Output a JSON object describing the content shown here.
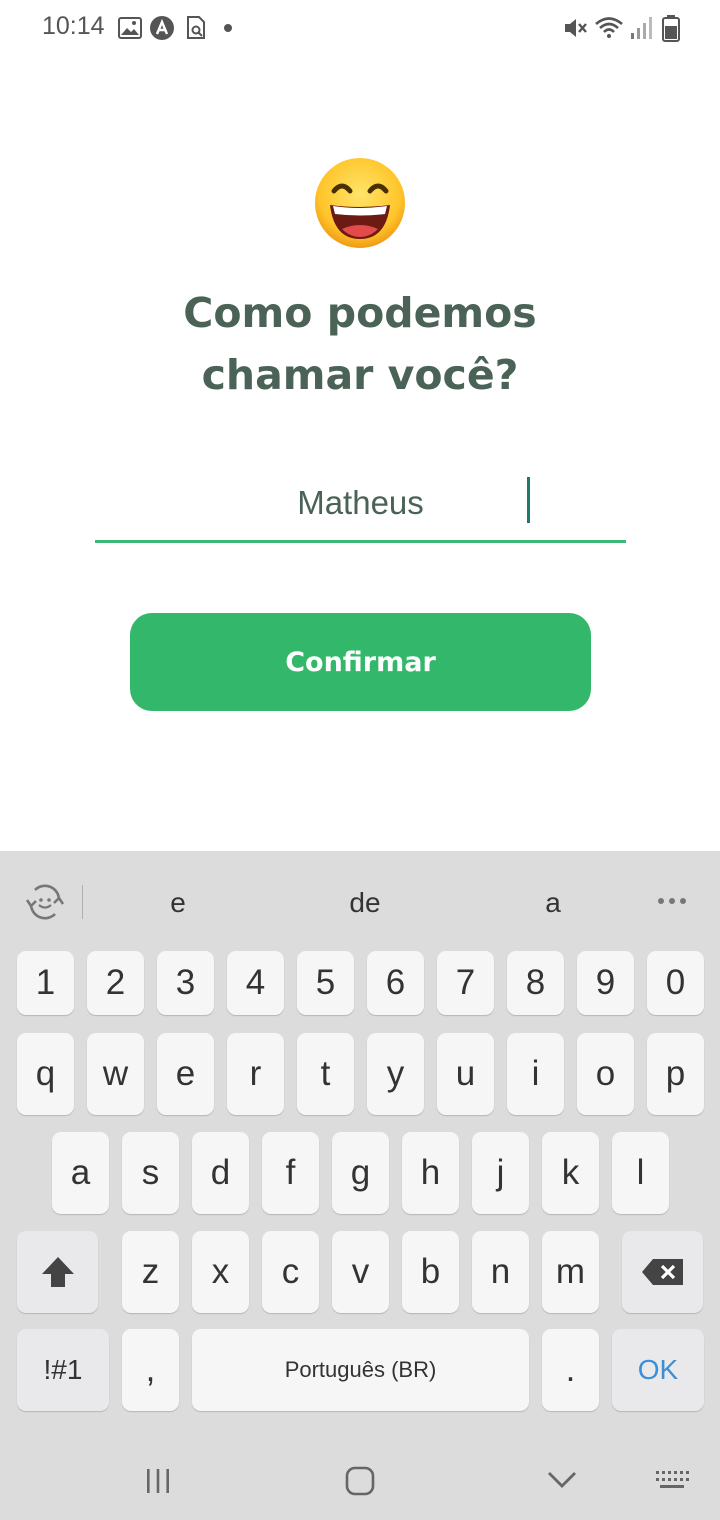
{
  "status_bar": {
    "time": "10:14"
  },
  "screen": {
    "title_line1": "Como podemos",
    "title_line2": "chamar você?",
    "name_input_value": "Matheus",
    "confirm_label": "Confirmar"
  },
  "keyboard": {
    "suggestions": [
      "e",
      "de",
      "a"
    ],
    "number_row": [
      "1",
      "2",
      "3",
      "4",
      "5",
      "6",
      "7",
      "8",
      "9",
      "0"
    ],
    "row1": [
      "q",
      "w",
      "e",
      "r",
      "t",
      "y",
      "u",
      "i",
      "o",
      "p"
    ],
    "row2": [
      "a",
      "s",
      "d",
      "f",
      "g",
      "h",
      "j",
      "k",
      "l"
    ],
    "row3": [
      "z",
      "x",
      "c",
      "v",
      "b",
      "n",
      "m"
    ],
    "symbols_label": "!#1",
    "comma_label": ",",
    "space_label": "Português (BR)",
    "period_label": ".",
    "ok_label": "OK"
  },
  "colors": {
    "accent_green": "#32b76b",
    "title_text": "#4a6356",
    "underline": "#3cb776",
    "ok_blue": "#3b8fd6",
    "keyboard_bg": "#dcdcdc"
  },
  "icons": [
    "gallery-icon",
    "app-a-icon",
    "search-doc-icon",
    "notification-dot-icon",
    "mute-icon",
    "wifi-icon",
    "signal-icon",
    "battery-icon",
    "grinning-emoji-icon",
    "refresh-emoji-icon",
    "more-icon",
    "shift-icon",
    "backspace-icon",
    "recents-icon",
    "home-icon",
    "back-icon",
    "keyboard-icon"
  ]
}
